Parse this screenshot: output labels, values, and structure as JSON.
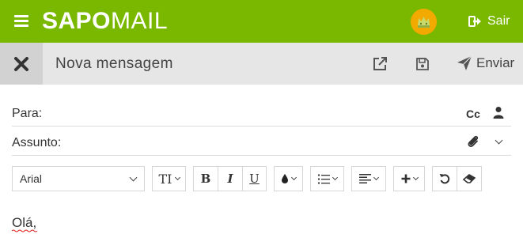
{
  "header": {
    "logo_bold": "SAPO",
    "logo_light": "MAIL",
    "logout_label": "Sair"
  },
  "compose": {
    "title": "Nova mensagem",
    "send_label": "Enviar"
  },
  "fields": {
    "to_label": "Para:",
    "to_value": "",
    "subject_label": "Assunto:",
    "subject_value": "",
    "cc_label": "Cc"
  },
  "toolbar": {
    "font_family": "Arial",
    "font_size_glyph": "TI",
    "bold": "B",
    "italic": "I",
    "underline": "U"
  },
  "message": {
    "body": "Olá,"
  },
  "colors": {
    "brand_green": "#7ab800",
    "compose_bar": "#e6e6e6",
    "close_box": "#d2d2d2"
  }
}
